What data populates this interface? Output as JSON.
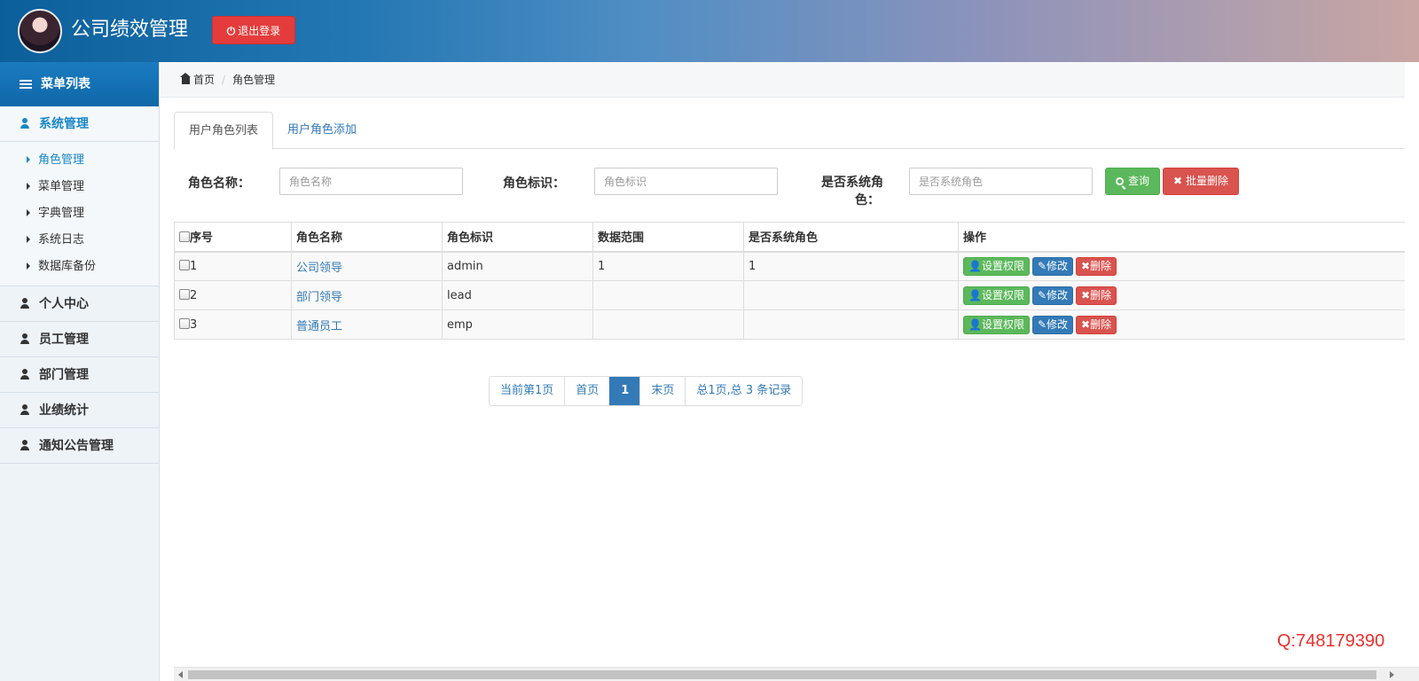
{
  "header": {
    "title": "公司绩效管理",
    "logout_label": "退出登录"
  },
  "sidebar": {
    "menu_title": "菜单列表",
    "groups": [
      {
        "label": "系统管理",
        "active": true
      },
      {
        "label": "个人中心"
      },
      {
        "label": "员工管理"
      },
      {
        "label": "部门管理"
      },
      {
        "label": "业绩统计"
      },
      {
        "label": "通知公告管理"
      }
    ],
    "subitems": [
      "角色管理",
      "菜单管理",
      "字典管理",
      "系统日志",
      "数据库备份"
    ]
  },
  "breadcrumb": {
    "home": "首页",
    "current": "角色管理"
  },
  "tabs": [
    "用户角色列表",
    "用户角色添加"
  ],
  "search": {
    "role_name_label": "角色名称：",
    "role_name_placeholder": "角色名称",
    "role_key_label": "角色标识：",
    "role_key_placeholder": "角色标识",
    "is_system_label_line1": "是否系统角",
    "is_system_label_line2": "色：",
    "is_system_placeholder": "是否系统角色",
    "query_label": "查询",
    "batch_delete_label": "批量删除"
  },
  "table": {
    "headers": [
      "序号",
      "角色名称",
      "角色标识",
      "数据范围",
      "是否系统角色",
      "操作"
    ],
    "rows": [
      {
        "index": "1",
        "name": "公司领导",
        "key": "admin",
        "scope": "1",
        "is_system": "1"
      },
      {
        "index": "2",
        "name": "部门领导",
        "key": "lead",
        "scope": "",
        "is_system": ""
      },
      {
        "index": "3",
        "name": "普通员工",
        "key": "emp",
        "scope": "",
        "is_system": ""
      }
    ],
    "actions": {
      "set_perm": "设置权限",
      "edit": "修改",
      "delete": "删除"
    }
  },
  "pagination": {
    "current_page_text": "当前第1页",
    "first": "首页",
    "page": "1",
    "last": "末页",
    "summary": "总1页,总 3 条记录"
  },
  "watermark": "Q:748179390",
  "colors": {
    "primary": "#337ab7",
    "success": "#5cb85c",
    "danger": "#d9534f",
    "sidebar_active": "#1a87c8"
  }
}
